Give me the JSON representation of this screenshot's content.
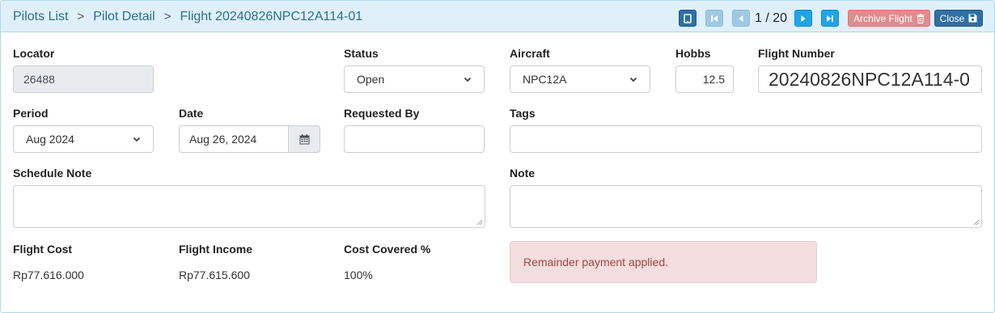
{
  "breadcrumb": {
    "items": [
      "Pilots List",
      "Pilot Detail"
    ],
    "current": "Flight 20240826NPC12A114-01",
    "separator": ">"
  },
  "toolbar": {
    "pager_text": "1 / 20",
    "archive_label": "Archive Flight",
    "close_label": "Close",
    "icons": [
      "tablet-icon",
      "first-page-icon",
      "prev-icon",
      "next-icon",
      "last-page-icon",
      "trash-icon",
      "save-icon"
    ]
  },
  "form": {
    "locator": {
      "label": "Locator",
      "value": "26488"
    },
    "status": {
      "label": "Status",
      "value": "Open"
    },
    "aircraft": {
      "label": "Aircraft",
      "value": "NPC12A"
    },
    "hobbs": {
      "label": "Hobbs",
      "value": "12.5"
    },
    "flight_number": {
      "label": "Flight Number",
      "value": "20240826NPC12A114-0"
    },
    "period": {
      "label": "Period",
      "value": "Aug 2024"
    },
    "date": {
      "label": "Date",
      "value": "Aug 26, 2024"
    },
    "requested_by": {
      "label": "Requested By",
      "value": ""
    },
    "tags": {
      "label": "Tags",
      "value": ""
    },
    "schedule_note": {
      "label": "Schedule Note",
      "value": ""
    },
    "note": {
      "label": "Note",
      "value": ""
    }
  },
  "summary": {
    "flight_cost": {
      "label": "Flight Cost",
      "value": "Rp77.616.000"
    },
    "flight_income": {
      "label": "Flight Income",
      "value": "Rp77.615.600"
    },
    "cost_covered": {
      "label": "Cost Covered %",
      "value": "100%"
    }
  },
  "alert": {
    "text": "Remainder payment applied."
  },
  "colors": {
    "header_bg": "#dff0fb",
    "link": "#2c6f94",
    "primary": "#2f6fa3",
    "danger_btn": "#e08c8c",
    "alert_bg": "#f2dede",
    "alert_text": "#a94442"
  }
}
